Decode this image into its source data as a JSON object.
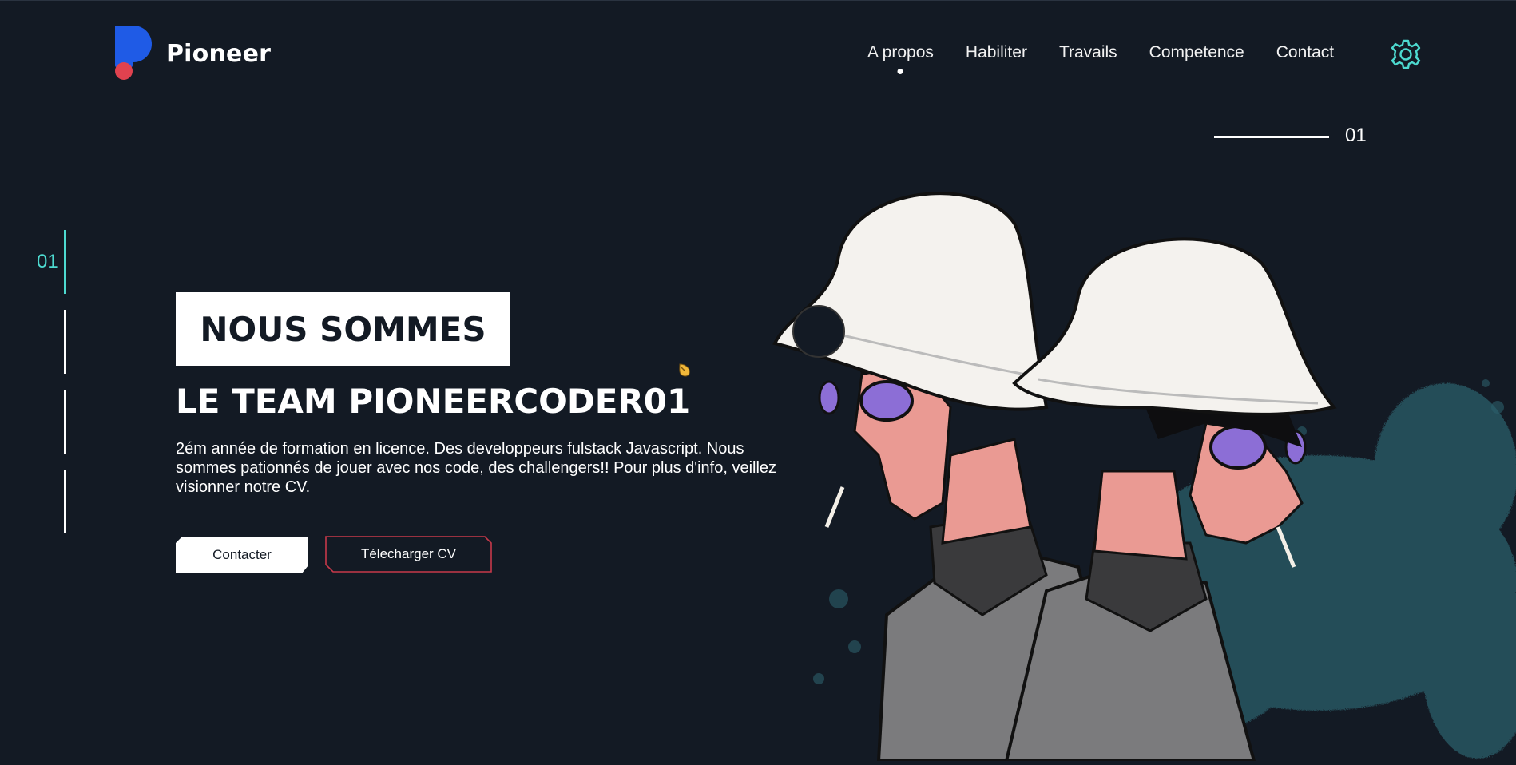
{
  "header": {
    "brand": "Pioneer",
    "nav": [
      {
        "label": "A propos",
        "active": true
      },
      {
        "label": "Habiliter",
        "active": false
      },
      {
        "label": "Travails",
        "active": false
      },
      {
        "label": "Competence",
        "active": false
      },
      {
        "label": "Contact",
        "active": false
      }
    ],
    "settings_icon": "gear-icon"
  },
  "slider": {
    "counter": "01",
    "side_counter": "01",
    "total_indicators": 4,
    "active_index": 0
  },
  "hero": {
    "title": "NOUS SOMMES",
    "subtitle": "LE TEAM PIONEERCODER01",
    "description": "2ém année de formation en licence. Des developpeurs fulstack Javascript. Nous sommes pationnés de jouer avec nos code, des challengers!! Pour plus d'info, veillez visionner notre CV.",
    "primary_button": "Contacter",
    "secondary_button": "Télecharger CV"
  },
  "colors": {
    "background": "#131a24",
    "accent_teal": "#4ddad0",
    "brand_blue": "#1f5be6",
    "brand_red": "#e0424f",
    "button_border_red": "#c7394a"
  }
}
